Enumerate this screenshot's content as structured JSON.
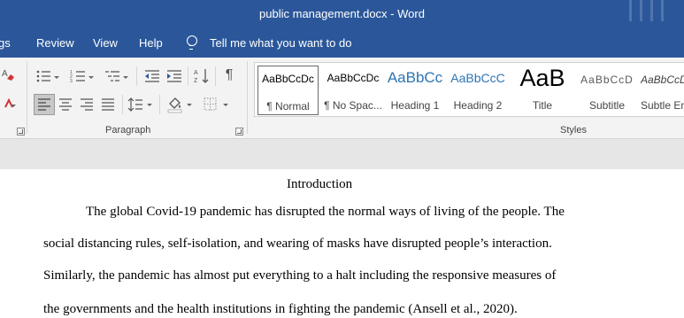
{
  "window": {
    "title": "public management.docx  -  Word"
  },
  "menu": {
    "items": [
      "gs",
      "Review",
      "View",
      "Help"
    ],
    "tell_me": "Tell me what you want to do"
  },
  "ribbon": {
    "paragraph_label": "Paragraph",
    "styles_label": "Styles",
    "styles": [
      {
        "sample": "AaBbCcDc",
        "name": "¶ Normal"
      },
      {
        "sample": "AaBbCcDc",
        "name": "¶ No Spac..."
      },
      {
        "sample": "AaBbCc",
        "name": "Heading 1"
      },
      {
        "sample": "AaBbCcC",
        "name": "Heading 2"
      },
      {
        "sample": "AaB",
        "name": "Title"
      },
      {
        "sample": "AaBbCcD",
        "name": "Subtitle"
      },
      {
        "sample": "AaBbCcDc",
        "name": "Subtle Em"
      }
    ],
    "icons": {
      "bullets": "bulleted-list-icon",
      "numbering": "numbered-list-icon",
      "multilevel": "multilevel-list-icon",
      "decrease_indent": "decrease-indent-icon",
      "increase_indent": "increase-indent-icon",
      "sort": "sort-icon",
      "pilcrow": "show-formatting-icon",
      "align_left": "align-left-icon",
      "center": "align-center-icon",
      "align_right": "align-right-icon",
      "justify": "justify-icon",
      "line_spacing": "line-spacing-icon",
      "shading": "shading-icon",
      "borders": "borders-icon"
    }
  },
  "colors": {
    "brand": "#2b579a",
    "heading_blue": "#2e74b5",
    "eraser_red": "#d13438"
  },
  "document": {
    "heading": "Introduction",
    "lines": [
      "The global Covid-19 pandemic has disrupted the normal ways of living of the people. The",
      "social distancing rules, self-isolation, and wearing of masks have disrupted people’s interaction.",
      "Similarly, the pandemic has almost put everything to a halt including the responsive measures of",
      "the governments and the health institutions in fighting the pandemic (Ansell et al., 2020)."
    ]
  }
}
